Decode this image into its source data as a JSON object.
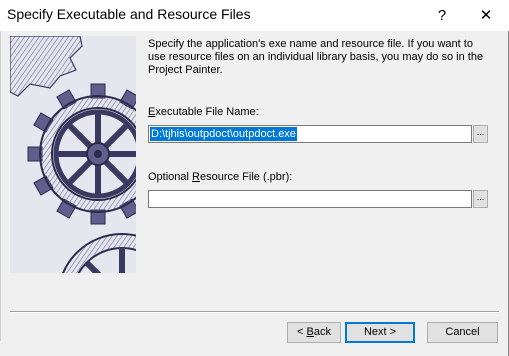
{
  "window": {
    "title": "Specify Executable and Resource Files",
    "help_glyph": "?",
    "close_glyph": "✕"
  },
  "description": "Specify the application's exe name and resource file.  If you want to use resource files on an individual library basis, you may do so in the Project Painter.",
  "exe_field": {
    "label_pre": "",
    "label_mnemonic": "E",
    "label_post": "xecutable File Name:",
    "value": "D:\\tjhis\\outpdoct\\outpdoct.exe",
    "browse_label": "..."
  },
  "resource_field": {
    "label_pre": "Optional ",
    "label_mnemonic": "R",
    "label_post": "esource File (.pbr):",
    "value": "",
    "browse_label": "..."
  },
  "buttons": {
    "back_glyph": "<",
    "back_mnemonic": "B",
    "back_rest": "ack",
    "next_label": "Next >",
    "cancel_label": "Cancel"
  }
}
